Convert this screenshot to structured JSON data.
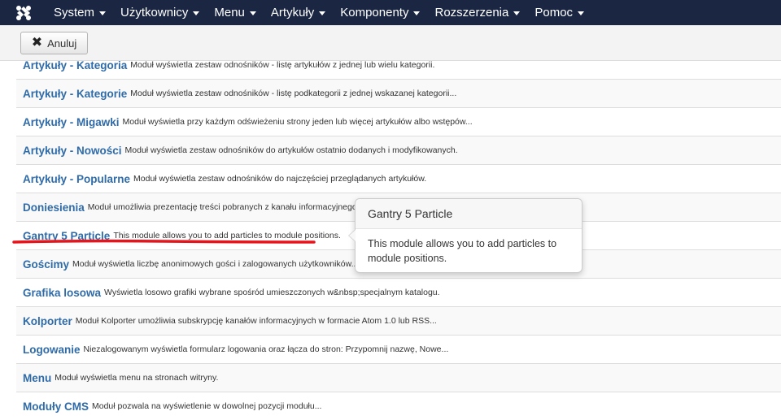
{
  "navbar": {
    "logo_icon": "joomla-logo-icon",
    "items": [
      {
        "label": "System"
      },
      {
        "label": "Użytkownicy"
      },
      {
        "label": "Menu"
      },
      {
        "label": "Artykuły"
      },
      {
        "label": "Komponenty"
      },
      {
        "label": "Rozszerzenia"
      },
      {
        "label": "Pomoc"
      }
    ]
  },
  "toolbar": {
    "cancel_label": "Anuluj",
    "cancel_icon": "close-icon"
  },
  "modules": [
    {
      "title": "Artykuły - Kategoria",
      "desc": "Moduł wyświetla zestaw odnośników - listę artykułów z jednej lub wielu kategorii."
    },
    {
      "title": "Artykuły - Kategorie",
      "desc": "Moduł wyświetla zestaw odnośników - listę podkategorii z jednej wskazanej kategorii..."
    },
    {
      "title": "Artykuły - Migawki",
      "desc": "Moduł wyświetla przy każdym odświeżeniu strony jeden lub więcej artykułów albo wstępów..."
    },
    {
      "title": "Artykuły - Nowości",
      "desc": "Moduł wyświetla zestaw odnośników do artykułów ostatnio dodanych i modyfikowanych."
    },
    {
      "title": "Artykuły - Popularne",
      "desc": "Moduł wyświetla zestaw odnośników do najczęściej przeglądanych artykułów."
    },
    {
      "title": "Doniesienia",
      "desc": "Moduł umożliwia prezentację treści pobranych z kanału informacyjnego..."
    },
    {
      "title": "Gantry 5 Particle",
      "desc": "This module allows you to add particles to module positions."
    },
    {
      "title": "Gościmy",
      "desc": "Moduł wyświetla liczbę anonimowych gości i zalogowanych użytkowników..."
    },
    {
      "title": "Grafika losowa",
      "desc": "Wyświetla losowo grafiki wybrane spośród umieszczonych w&nbsp;specjalnym katalogu."
    },
    {
      "title": "Kolporter",
      "desc": "Moduł Kolporter umożliwia subskrypcję kanałów informacyjnych w formacie Atom 1.0 lub RSS..."
    },
    {
      "title": "Logowanie",
      "desc": "Niezalogowanym wyświetla formularz logowania oraz łącza do stron: Przypomnij nazwę, Nowe..."
    },
    {
      "title": "Menu",
      "desc": "Moduł wyświetla menu na stronach witryny."
    },
    {
      "title": "Moduły CMS",
      "desc": "Moduł pozwala na wyświetlenie w dowolnej pozycji modułu..."
    }
  ],
  "popover": {
    "title": "Gantry 5 Particle",
    "body": "This module allows you to add particles to module positions."
  },
  "colors": {
    "navbar_bg": "#1a2642",
    "link": "#2f6ba8",
    "annotation_underline": "#e8141b"
  }
}
